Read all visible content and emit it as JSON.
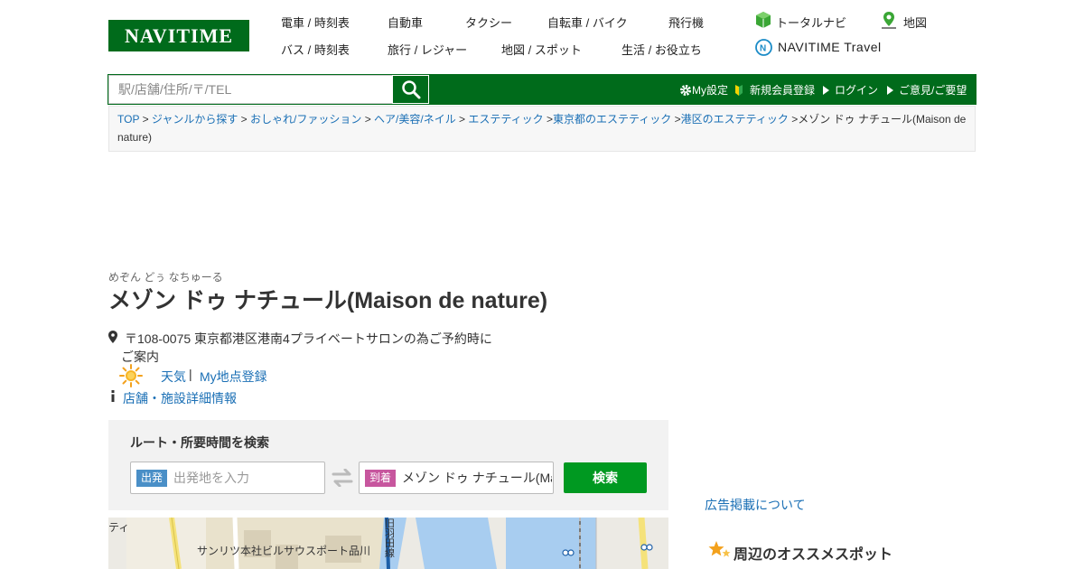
{
  "logo": "NAVITIME",
  "nav": {
    "row1": [
      "電車 / 時刻表",
      "自動車",
      "タクシー",
      "自転車 / バイク",
      "飛行機"
    ],
    "row2": [
      "バス / 時刻表",
      "旅行 / レジャー",
      "地図 / スポット",
      "生活 / お役立ち"
    ],
    "total_navi": "トータルナビ",
    "map": "地図",
    "travel": "NAVITIME Travel"
  },
  "search": {
    "placeholder": "駅/店舗/住所/〒/TEL"
  },
  "utility": {
    "my_settings": "My設定",
    "register": "新規会員登録",
    "login": "ログイン",
    "feedback": "ご意見/ご要望"
  },
  "breadcrumb": {
    "items": [
      "TOP",
      "ジャンルから探す",
      "おしゃれ/ファッション",
      "ヘア/美容/ネイル",
      "エステティック",
      "東京都のエステティック",
      "港区のエステティック"
    ],
    "current": "メゾン ドゥ ナチュール(Maison de nature)"
  },
  "spot": {
    "reading": "めぞん どぅ なちゅーる",
    "name": "メゾン ドゥ ナチュール(Maison de nature)",
    "address_line1": "〒108-0075 東京都港区港南4プライベートサロンの為ご予約時に",
    "address_line2": "ご案内",
    "weather": "天気",
    "my_point": "My地点登録",
    "detail": "店舗・施設詳細情報"
  },
  "route": {
    "title": "ルート・所要時間を検索",
    "from_tag": "出発",
    "from_placeholder": "出発地を入力",
    "to_tag": "到着",
    "to_value": "メゾン ドゥ ナチュール(Ma",
    "search": "検索"
  },
  "map": {
    "label_building": "サンリツ本社ビルサウスポート品川",
    "label_left": "ティ",
    "label_vertical": "旧羽田線"
  },
  "right": {
    "ad": "広告掲載について",
    "recommend": "周辺のオススメスポット"
  },
  "colors": {
    "brand_green": "#006b1b",
    "button_green": "#009921",
    "link_blue": "#1a6fb5"
  }
}
